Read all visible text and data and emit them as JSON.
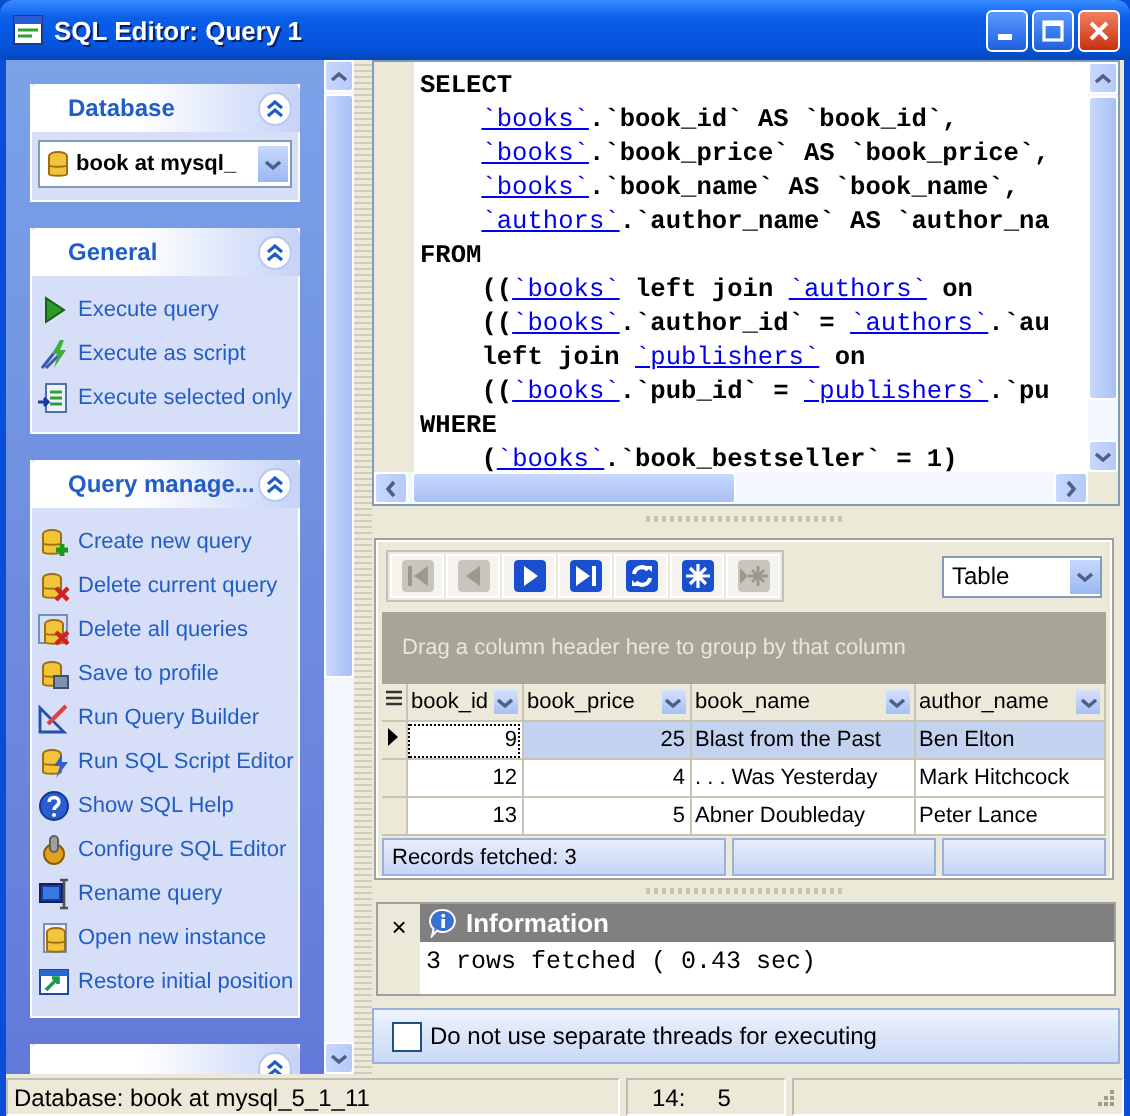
{
  "window": {
    "title": "SQL Editor: Query 1"
  },
  "sidebar": {
    "panels": [
      {
        "kind": "database",
        "title": "Database",
        "expanded": true,
        "select": {
          "value": "book at mysql_"
        }
      },
      {
        "kind": "links",
        "title": "General",
        "expanded": true,
        "items": [
          "Execute query",
          "Execute as script",
          "Execute selected only"
        ]
      },
      {
        "kind": "links",
        "title": "Query manage...",
        "expanded": true,
        "items": [
          "Create new query",
          "Delete current query",
          "Delete all queries",
          "Save to profile",
          "Run Query Builder",
          "Run SQL Script Editor",
          "Show SQL Help",
          "Configure SQL Editor",
          "Rename query",
          "Open new instance",
          "Restore initial position"
        ]
      },
      {
        "kind": "cut",
        "expanded": true
      }
    ]
  },
  "editor": {
    "lines": [
      {
        "indented": false,
        "tokens": [
          {
            "kind": "keyword",
            "text": "SELECT"
          }
        ]
      },
      {
        "indented": true,
        "tokens": [
          {
            "kind": "table",
            "text": "`books`"
          },
          {
            "kind": "plain",
            "text": ".`book_id` AS `book_id`,"
          }
        ]
      },
      {
        "indented": true,
        "tokens": [
          {
            "kind": "table",
            "text": "`books`"
          },
          {
            "kind": "plain",
            "text": ".`book_price` AS `book_price`,"
          }
        ]
      },
      {
        "indented": true,
        "tokens": [
          {
            "kind": "table",
            "text": "`books`"
          },
          {
            "kind": "plain",
            "text": ".`book_name` AS `book_name`,"
          }
        ]
      },
      {
        "indented": true,
        "tokens": [
          {
            "kind": "table",
            "text": "`authors`"
          },
          {
            "kind": "plain",
            "text": ".`author_name` AS `author_na"
          }
        ]
      },
      {
        "indented": false,
        "tokens": [
          {
            "kind": "keyword",
            "text": "FROM"
          }
        ]
      },
      {
        "indented": true,
        "tokens": [
          {
            "kind": "plain",
            "text": "(("
          },
          {
            "kind": "table",
            "text": "`books`"
          },
          {
            "kind": "plain",
            "text": " left join "
          },
          {
            "kind": "table",
            "text": "`authors`"
          },
          {
            "kind": "plain",
            "text": " on"
          }
        ]
      },
      {
        "indented": true,
        "tokens": [
          {
            "kind": "plain",
            "text": "(("
          },
          {
            "kind": "table",
            "text": "`books`"
          },
          {
            "kind": "plain",
            "text": ".`author_id` = "
          },
          {
            "kind": "table",
            "text": "`authors`"
          },
          {
            "kind": "plain",
            "text": ".`au"
          }
        ]
      },
      {
        "indented": true,
        "tokens": [
          {
            "kind": "plain",
            "text": "left join "
          },
          {
            "kind": "table",
            "text": "`publishers`"
          },
          {
            "kind": "plain",
            "text": " on"
          }
        ]
      },
      {
        "indented": true,
        "tokens": [
          {
            "kind": "plain",
            "text": "(("
          },
          {
            "kind": "table",
            "text": "`books`"
          },
          {
            "kind": "plain",
            "text": ".`pub_id` = "
          },
          {
            "kind": "table",
            "text": "`publishers`"
          },
          {
            "kind": "plain",
            "text": ".`pu"
          }
        ]
      },
      {
        "indented": false,
        "tokens": [
          {
            "kind": "keyword",
            "text": "WHERE"
          }
        ]
      },
      {
        "indented": true,
        "tokens": [
          {
            "kind": "plain",
            "text": "("
          },
          {
            "kind": "table",
            "text": "`books`"
          },
          {
            "kind": "plain",
            "text": ".`book_bestseller` = 1)"
          }
        ]
      }
    ]
  },
  "grid": {
    "nav_buttons": [
      {
        "disabled": true
      },
      {
        "disabled": true
      },
      {
        "disabled": false
      },
      {
        "disabled": false
      },
      {
        "disabled": false
      },
      {
        "disabled": false
      },
      {
        "disabled": true
      }
    ],
    "view": {
      "value": "Table"
    },
    "group_hint": "Drag a column header here to group by that column",
    "columns": [
      "book_id",
      "book_price",
      "book_name",
      "author_name"
    ],
    "rows": [
      {
        "selected": true,
        "cells": [
          "9",
          "25",
          "Blast from the Past",
          "Ben Elton"
        ]
      },
      {
        "selected": false,
        "cells": [
          "12",
          "4",
          ". . . Was Yesterday",
          "Mark Hitchcock"
        ]
      },
      {
        "selected": false,
        "cells": [
          "13",
          "5",
          "Abner Doubleday",
          "Peter Lance"
        ]
      }
    ],
    "status": "Records fetched: 3"
  },
  "messages": {
    "close": "×",
    "title": "Information",
    "text": "3 rows fetched ( 0.43 sec)"
  },
  "option": {
    "label": "Do not use separate threads for executing",
    "checked": false
  },
  "status_bar": {
    "database": "Database: book at mysql_5_1_11",
    "line": "14:",
    "column": "5"
  }
}
